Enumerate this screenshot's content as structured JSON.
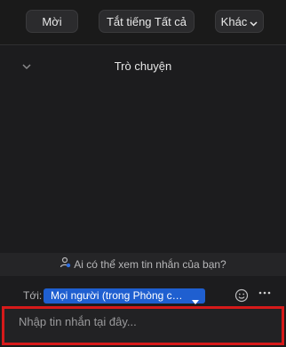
{
  "toolbar": {
    "invite_label": "Mời",
    "mute_all_label": "Tắt tiếng Tất cả",
    "more_label": "Khác"
  },
  "chat": {
    "title": "Trò chuyện",
    "privacy_notice": "Ai có thể xem tin nhắn của bạn?",
    "to_label": "Tới:",
    "recipient": "Mọi người (trong Phòng chờ)",
    "input_placeholder": "Nhập tin nhắn tại đây..."
  },
  "colors": {
    "background": "#1c1c1e",
    "recipient_accent": "#1f5fd0",
    "highlight_border": "#d61a1a"
  }
}
